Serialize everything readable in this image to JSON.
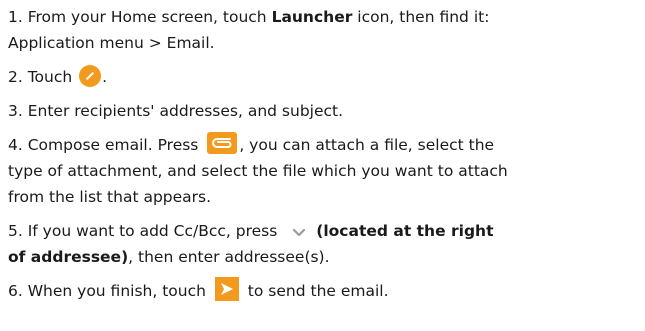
{
  "steps": [
    {
      "s1_a": "1. From your Home screen, touch ",
      "s1_b": "Launcher",
      "s1_c": " icon, then find it:",
      "s1_d": "Application menu > Email."
    },
    {
      "s2_a": "2. Touch ",
      "s2_b": "."
    },
    {
      "s3": "3. Enter recipients' addresses, and subject."
    },
    {
      "s4_a": "4. Compose email. Press ",
      "s4_b": ", you can attach a file, select the",
      "s4_c": "type of attachment, and select the file which you want to attach",
      "s4_d": "from the list that appears."
    },
    {
      "s5_a": "5. If you want to add Cc/Bcc, press ",
      "s5_b": "(located at the right",
      "s5_c": "of addressee)",
      "s5_d": ", then enter addressee(s)."
    },
    {
      "s6_a": "6. When you finish, touch ",
      "s6_b": " to send the email."
    }
  ],
  "icons": {
    "compose": "compose-pencil-icon",
    "attach": "paperclip-attach-icon",
    "chevron": "chevron-down-icon",
    "send": "send-arrow-icon"
  },
  "colors": {
    "accent": "#f39a1e",
    "text": "#1a1a1a",
    "chevron": "#9a9a9a"
  }
}
